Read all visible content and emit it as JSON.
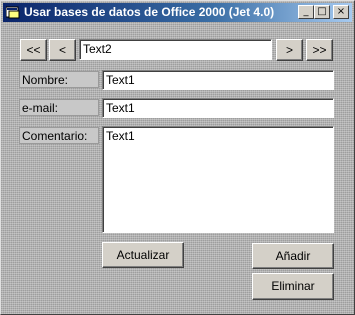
{
  "window": {
    "title": "Usar bases de datos de Office 2000 (Jet 4.0)"
  },
  "nav": {
    "first": "<<",
    "prev": "<",
    "record": "Text2",
    "next": ">",
    "last": ">>"
  },
  "fields": {
    "nombre": {
      "label": "Nombre:",
      "value": "Text1"
    },
    "email": {
      "label": "e-mail:",
      "value": "Text1"
    },
    "comentario": {
      "label": "Comentario:",
      "value": "Text1"
    }
  },
  "buttons": {
    "actualizar": "Actualizar",
    "anadir": "Añadir",
    "eliminar": "Eliminar"
  },
  "caption_buttons": {
    "minimize": "_",
    "maximize": "□",
    "close": "×"
  }
}
